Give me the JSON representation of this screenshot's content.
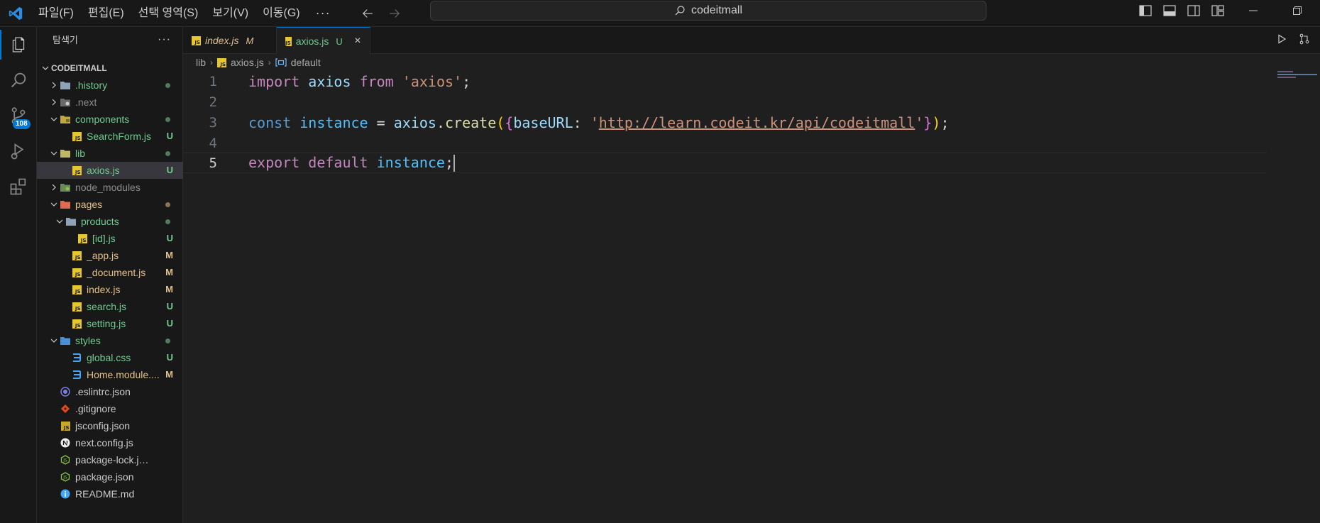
{
  "titlebar": {
    "menu": [
      "파일(F)",
      "편집(E)",
      "선택 영역(S)",
      "보기(V)",
      "이동(G)"
    ],
    "more": "···",
    "search_text": "codeitmall"
  },
  "activitybar": {
    "source_control_badge": "108"
  },
  "sidebar": {
    "title": "탐색기",
    "more": "···",
    "root": "CODEITMALL",
    "items": [
      {
        "label": ".history",
        "status": ""
      },
      {
        "label": ".next",
        "status": ""
      },
      {
        "label": "components",
        "status": ""
      },
      {
        "label": "SearchForm.js",
        "status": "U"
      },
      {
        "label": "lib",
        "status": ""
      },
      {
        "label": "axios.js",
        "status": "U"
      },
      {
        "label": "node_modules",
        "status": ""
      },
      {
        "label": "pages",
        "status": ""
      },
      {
        "label": "products",
        "status": ""
      },
      {
        "label": "[id].js",
        "status": "U"
      },
      {
        "label": "_app.js",
        "status": "M"
      },
      {
        "label": "_document.js",
        "status": "M"
      },
      {
        "label": "index.js",
        "status": "M"
      },
      {
        "label": "search.js",
        "status": "U"
      },
      {
        "label": "setting.js",
        "status": "U"
      },
      {
        "label": "styles",
        "status": ""
      },
      {
        "label": "global.css",
        "status": "U"
      },
      {
        "label": "Home.module....",
        "status": "M"
      },
      {
        "label": ".eslintrc.json",
        "status": ""
      },
      {
        "label": ".gitignore",
        "status": ""
      },
      {
        "label": "jsconfig.json",
        "status": ""
      },
      {
        "label": "next.config.js",
        "status": ""
      },
      {
        "label": "package-lock.json",
        "status": ""
      },
      {
        "label": "package.json",
        "status": ""
      },
      {
        "label": "README.md",
        "status": ""
      }
    ]
  },
  "tabs": [
    {
      "label": "index.js",
      "status": "M"
    },
    {
      "label": "axios.js",
      "status": "U"
    }
  ],
  "breadcrumb": {
    "folder": "lib",
    "file": "axios.js",
    "symbol": "default"
  },
  "editor": {
    "line_numbers": [
      "1",
      "2",
      "3",
      "4",
      "5"
    ],
    "line1": {
      "kw_import": "import",
      "id": "axios",
      "kw_from": "from",
      "str": "'axios'",
      "semi": ";"
    },
    "line3": {
      "kw_const": "const",
      "id": "instance",
      "eq": "=",
      "obj": "axios",
      "dot": ".",
      "fn": "create",
      "paren_open": "(",
      "brace_open": "{",
      "prop": "baseURL",
      "colon": ":",
      "str_q1": "'",
      "url": "http://learn.codeit.kr/api/codeitmall",
      "str_q2": "'",
      "brace_close": "}",
      "paren_close": ")",
      "semi": ";"
    },
    "line5": {
      "kw_export": "export",
      "kw_default": "default",
      "id": "instance",
      "semi": ";"
    }
  },
  "colors": {
    "accent": "#0078d4",
    "untracked": "#73c991",
    "modified": "#e2c08d"
  }
}
